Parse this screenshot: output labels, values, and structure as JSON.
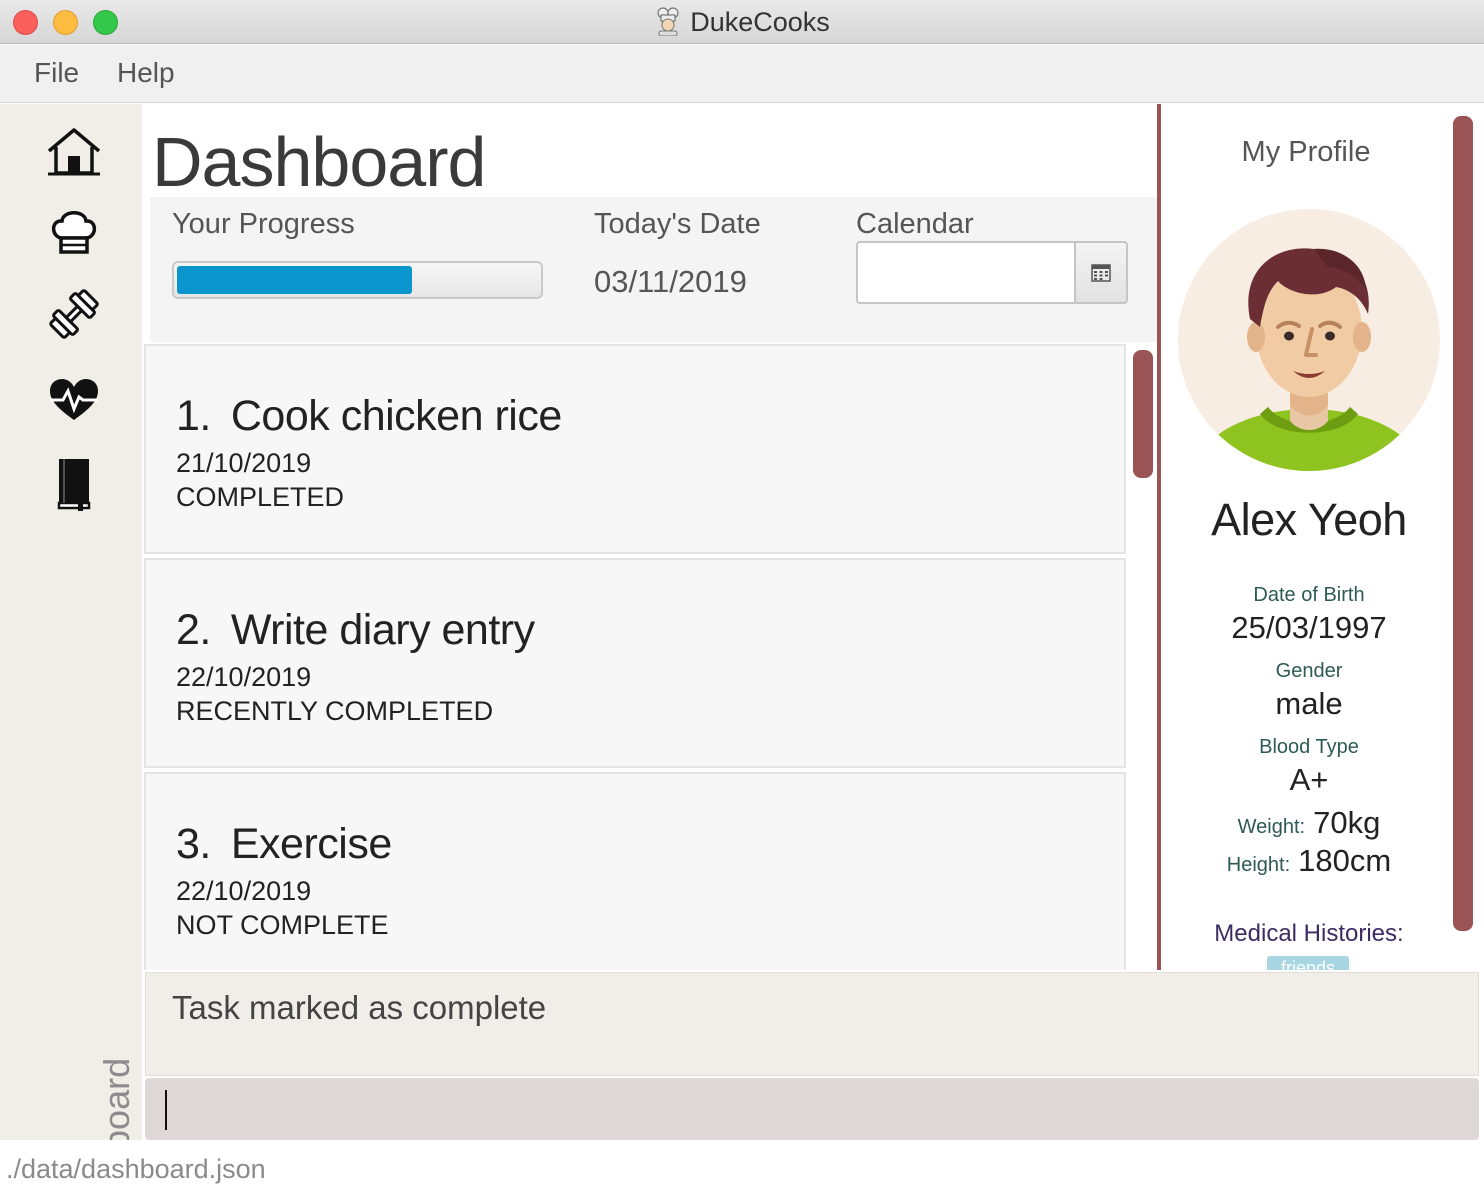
{
  "window": {
    "title": "DukeCooks"
  },
  "menu": [
    "File",
    "Help"
  ],
  "sidebar": {
    "items": [
      {
        "name": "home"
      },
      {
        "name": "chef"
      },
      {
        "name": "exercise"
      },
      {
        "name": "health"
      },
      {
        "name": "diary"
      }
    ],
    "vertical_label": "Dashboard"
  },
  "main": {
    "title": "Dashboard",
    "progress": {
      "label": "Your Progress",
      "value_fraction": 0.65
    },
    "today": {
      "label": "Today's Date",
      "value": "03/11/2019"
    },
    "calendar": {
      "label": "Calendar",
      "value": ""
    },
    "tasks": [
      {
        "num": "1.",
        "title": "Cook chicken rice",
        "date": "21/10/2019",
        "status": "COMPLETED"
      },
      {
        "num": "2.",
        "title": "Write diary entry",
        "date": "22/10/2019",
        "status": "RECENTLY COMPLETED"
      },
      {
        "num": "3.",
        "title": "Exercise",
        "date": "22/10/2019",
        "status": "NOT COMPLETE"
      }
    ]
  },
  "profile": {
    "header": "My Profile",
    "name": "Alex Yeoh",
    "dob_label": "Date of Birth",
    "dob": "25/03/1997",
    "gender_label": "Gender",
    "gender": "male",
    "blood_label": "Blood Type",
    "blood": "A+",
    "weight_label": "Weight:",
    "weight": "70kg",
    "height_label": "Height:",
    "height": "180cm",
    "medical_label": "Medical Histories:",
    "medical_tag": "friends"
  },
  "result": "Task marked as complete",
  "command": {
    "value": ""
  },
  "status": "./data/dashboard.json",
  "colors": {
    "accent": "#9a5455",
    "progress": "#0a96cc",
    "shirt": "#8fc31f"
  }
}
